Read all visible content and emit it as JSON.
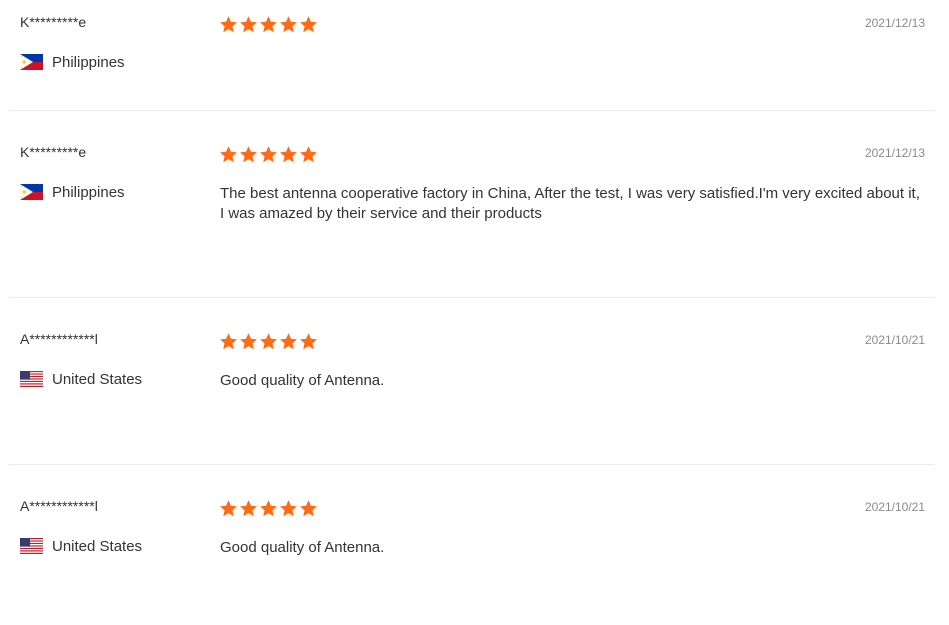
{
  "colors": {
    "star": "#ff6a14",
    "divider": "#ececec",
    "text": "#333333",
    "date": "#8a8a8a"
  },
  "reviews": [
    {
      "name": "K*********e",
      "country": "Philippines",
      "flag_icon": "philippines-flag-icon",
      "rating": 5,
      "date": "2021/12/13",
      "text": ""
    },
    {
      "name": "K*********e",
      "country": "Philippines",
      "flag_icon": "philippines-flag-icon",
      "rating": 5,
      "date": "2021/12/13",
      "text": "The best antenna cooperative factory in China, After the test, I was very satisfied.I'm very excited about it,　I was amazed by their service and their products"
    },
    {
      "name": "A************l",
      "country": "United States",
      "flag_icon": "united-states-flag-icon",
      "rating": 5,
      "date": "2021/10/21",
      "text": "Good quality of Antenna."
    },
    {
      "name": "A************l",
      "country": "United States",
      "flag_icon": "united-states-flag-icon",
      "rating": 5,
      "date": "2021/10/21",
      "text": "Good quality of Antenna."
    }
  ]
}
